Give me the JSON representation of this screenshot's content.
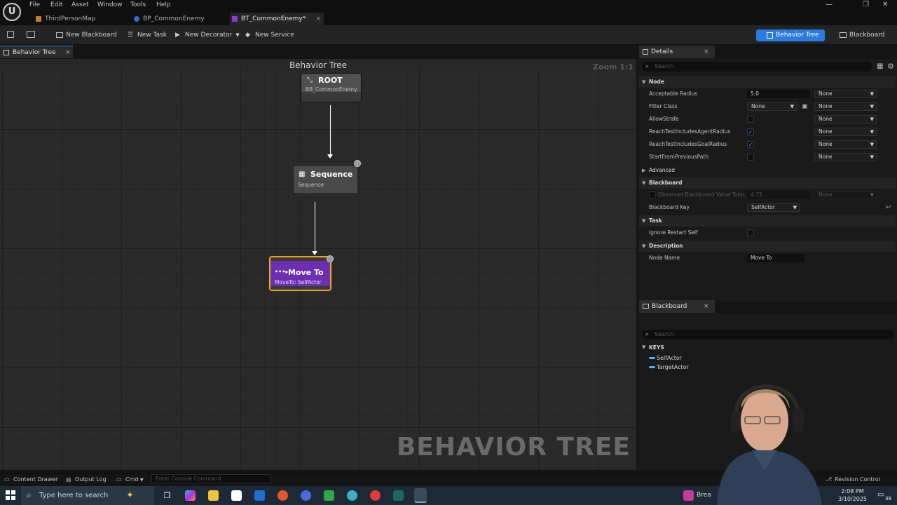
{
  "menu": [
    "File",
    "Edit",
    "Asset",
    "Window",
    "Tools",
    "Help"
  ],
  "doc_tabs": [
    {
      "label": "ThirdPersonMap"
    },
    {
      "label": "BP_CommonEnemy"
    },
    {
      "label": "BT_CommonEnemy*",
      "close": "×"
    }
  ],
  "toolbar": {
    "new_blackboard": "New Blackboard",
    "new_task": "New Task",
    "new_decorator": "New Decorator",
    "new_service": "New Service",
    "mode_behavior_tree": "Behavior Tree",
    "mode_blackboard": "Blackboard"
  },
  "graph": {
    "tab_label": "Behavior Tree",
    "title": "Behavior Tree",
    "zoom": "Zoom 1:1",
    "watermark": "BEHAVIOR TREE",
    "nodes": {
      "root": {
        "title": "ROOT",
        "subtitle": "BB_CommonEnemy"
      },
      "sequence": {
        "title": "Sequence",
        "subtitle": "Sequence"
      },
      "moveto": {
        "title": "Move To",
        "subtitle": "MoveTo: SelfActor"
      }
    }
  },
  "details": {
    "tab_label": "Details",
    "search_placeholder": "Search",
    "categories": {
      "node": "Node",
      "advanced": "Advanced",
      "blackboard": "Blackboard",
      "task": "Task",
      "description": "Description"
    },
    "props": {
      "acceptable_radius": {
        "label": "Acceptable Radius",
        "value": "5.0",
        "bind": "None"
      },
      "filter_class": {
        "label": "Filter Class",
        "value": "None",
        "bind": "None"
      },
      "allow_strafe": {
        "label": "AllowStrafe",
        "checked": false,
        "bind": "None"
      },
      "reach_agent": {
        "label": "ReachTestIncludesAgentRadius",
        "checked": true,
        "bind": "None"
      },
      "reach_goal": {
        "label": "ReachTestIncludesGoalRadius",
        "checked": true,
        "bind": "None"
      },
      "start_prev": {
        "label": "StartFromPreviousPath",
        "checked": false,
        "bind": "None"
      },
      "observed_tol": {
        "label": "Observed Blackboard Value Toler...",
        "value": "4.75",
        "bind": "None"
      },
      "bb_key": {
        "label": "Blackboard Key",
        "value": "SelfActor"
      },
      "ignore_restart": {
        "label": "Ignore Restart Self",
        "checked": false
      },
      "node_name": {
        "label": "Node Name",
        "value": "Move To"
      }
    }
  },
  "blackboard": {
    "tab_label": "Blackboard",
    "search_placeholder": "Search",
    "keys_header": "KEYS",
    "keys": [
      "SelfActor",
      "TargetActor"
    ]
  },
  "statusbar": {
    "content_drawer": "Content Drawer",
    "output_log": "Output Log",
    "cmd": "Cmd",
    "console_placeholder": "Enter Console Command",
    "revision_control": "Revision Control"
  },
  "taskbar": {
    "search_placeholder": "Type here to search",
    "time": "2:08 PM",
    "date": "3/10/2025",
    "badge": "38",
    "weather_partial": "Brea"
  },
  "colors": {
    "accent": "#2a7ae2",
    "task_node": "#6b2fb0",
    "selected_outline": "#e8a817"
  }
}
